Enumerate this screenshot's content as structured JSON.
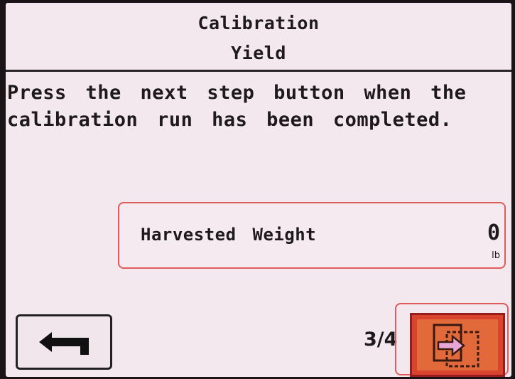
{
  "header": {
    "title": "Calibration",
    "subtitle": "Yield"
  },
  "instructions": {
    "line1": "Press the next step button when the",
    "line2": "calibration run has been completed."
  },
  "weight_field": {
    "label": "Harvested Weight",
    "value": "0",
    "unit": "lb"
  },
  "navigation": {
    "step": "3/4",
    "back_icon": "back-arrow-icon",
    "next_icon": "next-step-icon"
  },
  "colors": {
    "screen_background": "#f3e8ee",
    "highlight_border": "#e05a5a",
    "next_button": "#d9442f",
    "next_arrow": "#e6a7d6"
  }
}
